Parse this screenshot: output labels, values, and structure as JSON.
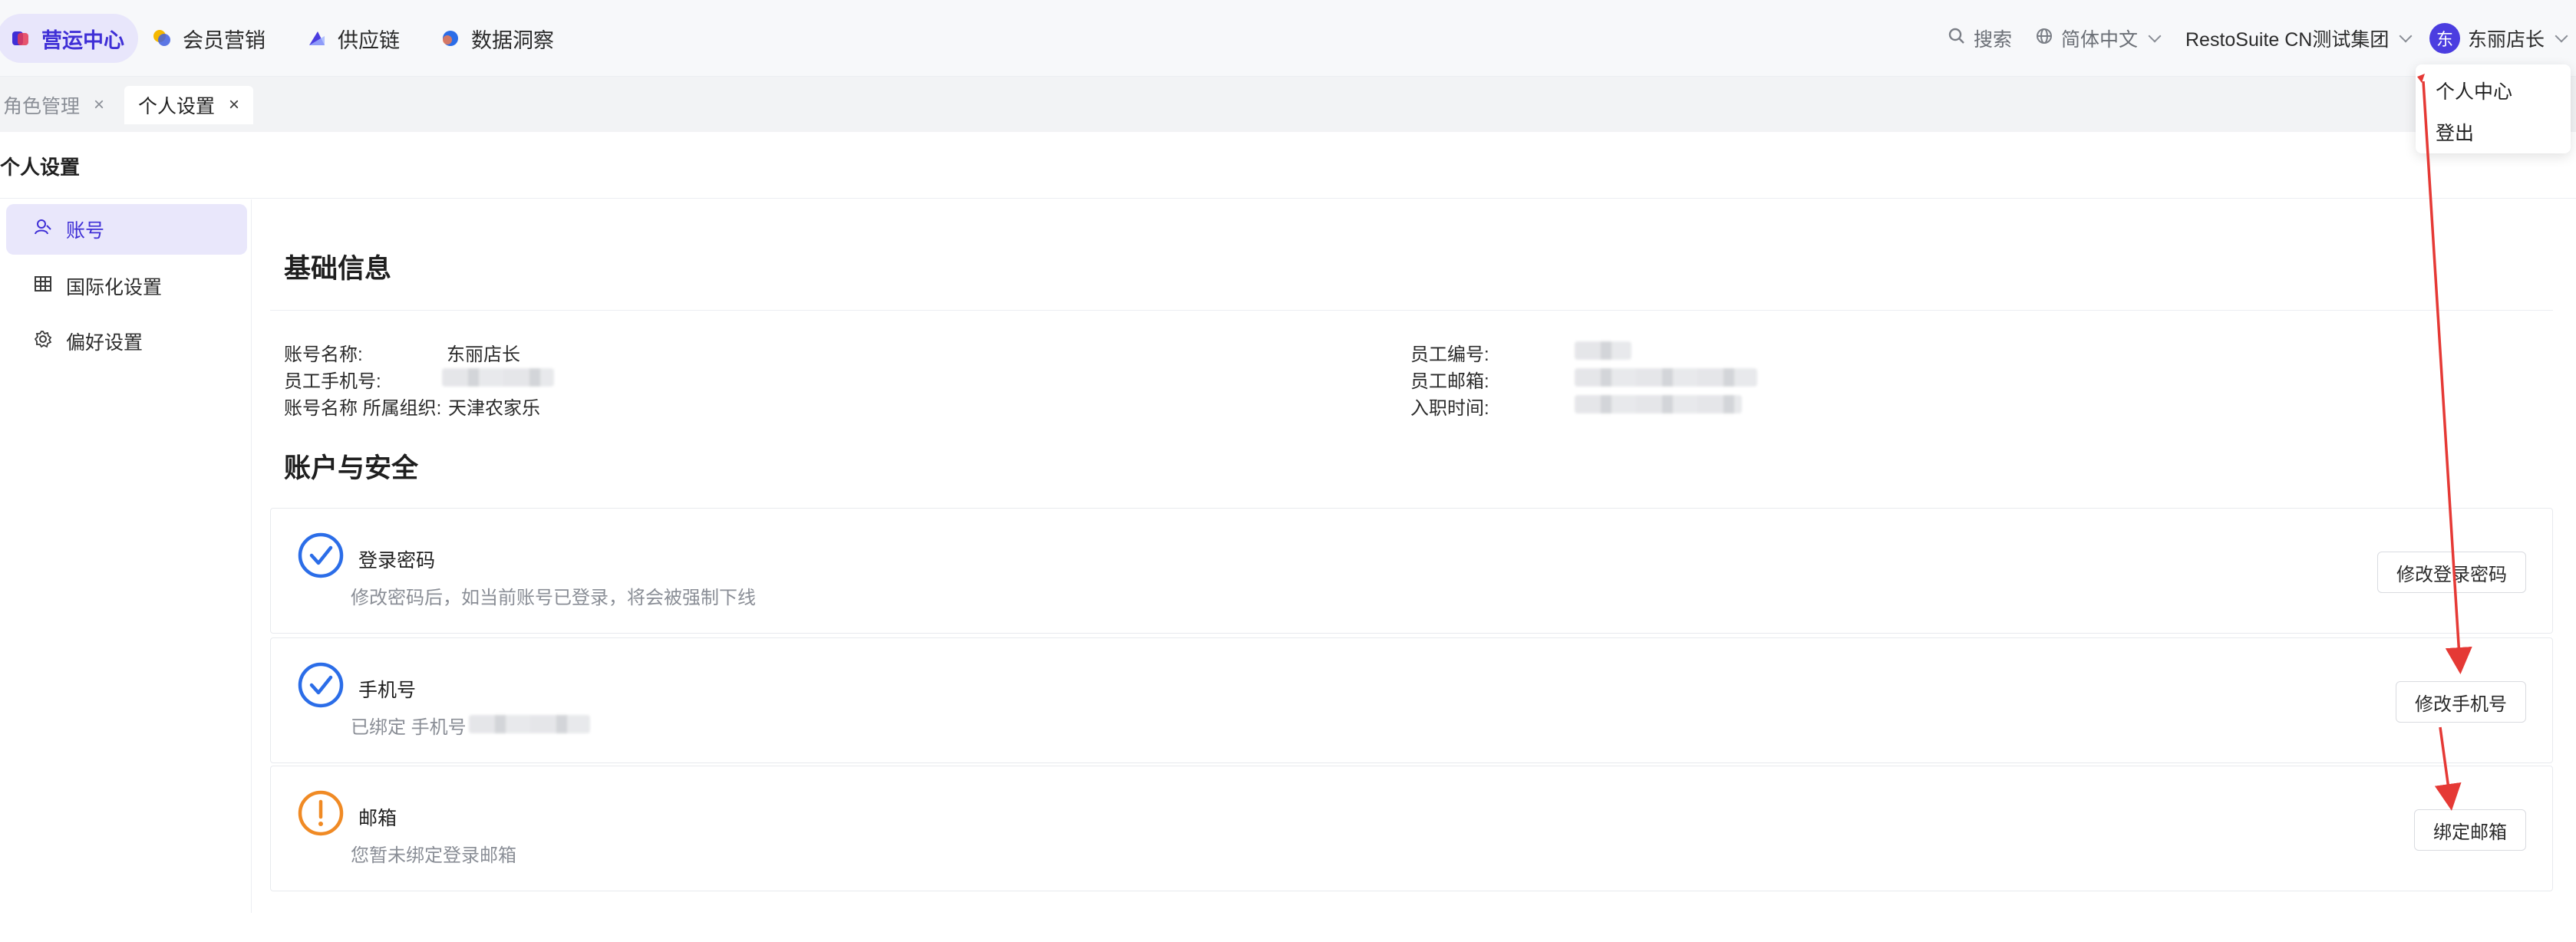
{
  "topnav": {
    "items": [
      {
        "label": "营运中心",
        "active": true
      },
      {
        "label": "会员营销",
        "active": false
      },
      {
        "label": "供应链",
        "active": false
      },
      {
        "label": "数据洞察",
        "active": false
      }
    ],
    "search_label": "搜索",
    "language_label": "简体中文",
    "org_label": "RestoSuite CN测试集团",
    "avatar_char": "东",
    "user_name": "东丽店长"
  },
  "dropdown": {
    "items": [
      "个人中心",
      "登出"
    ]
  },
  "tabs": [
    {
      "label": "角色管理",
      "active": false,
      "close": "×"
    },
    {
      "label": "个人设置",
      "active": true,
      "close": "×"
    }
  ],
  "page": {
    "title": "个人设置"
  },
  "sidebar": {
    "items": [
      {
        "label": "账号",
        "icon": "user-icon",
        "active": true
      },
      {
        "label": "国际化设置",
        "icon": "grid-icon",
        "active": false
      },
      {
        "label": "偏好设置",
        "icon": "gear-icon",
        "active": false
      }
    ]
  },
  "basic_info": {
    "title": "基础信息",
    "left": [
      {
        "label": "账号名称:",
        "value": "东丽店长"
      },
      {
        "label": "员工手机号:",
        "value": ""
      },
      {
        "label": "账号名称 所属组织:",
        "value": "天津农家乐"
      }
    ],
    "right": [
      {
        "label": "员工编号:",
        "value": ""
      },
      {
        "label": "员工邮箱:",
        "value": ""
      },
      {
        "label": "入职时间:",
        "value": ""
      }
    ]
  },
  "security": {
    "title": "账户与安全",
    "cards": [
      {
        "title": "登录密码",
        "desc": "修改密码后，如当前账号已登录，将会被强制下线",
        "button": "修改登录密码",
        "status": "ok"
      },
      {
        "title": "手机号",
        "desc": "已绑定 手机号",
        "button": "修改手机号",
        "status": "ok"
      },
      {
        "title": "邮箱",
        "desc": "您暂未绑定登录邮箱",
        "button": "绑定邮箱",
        "status": "warning"
      }
    ]
  },
  "colors": {
    "accent": "#3f2fd6",
    "ok": "#2b6de8",
    "warning": "#f08a24",
    "annotation": "#e53935"
  }
}
